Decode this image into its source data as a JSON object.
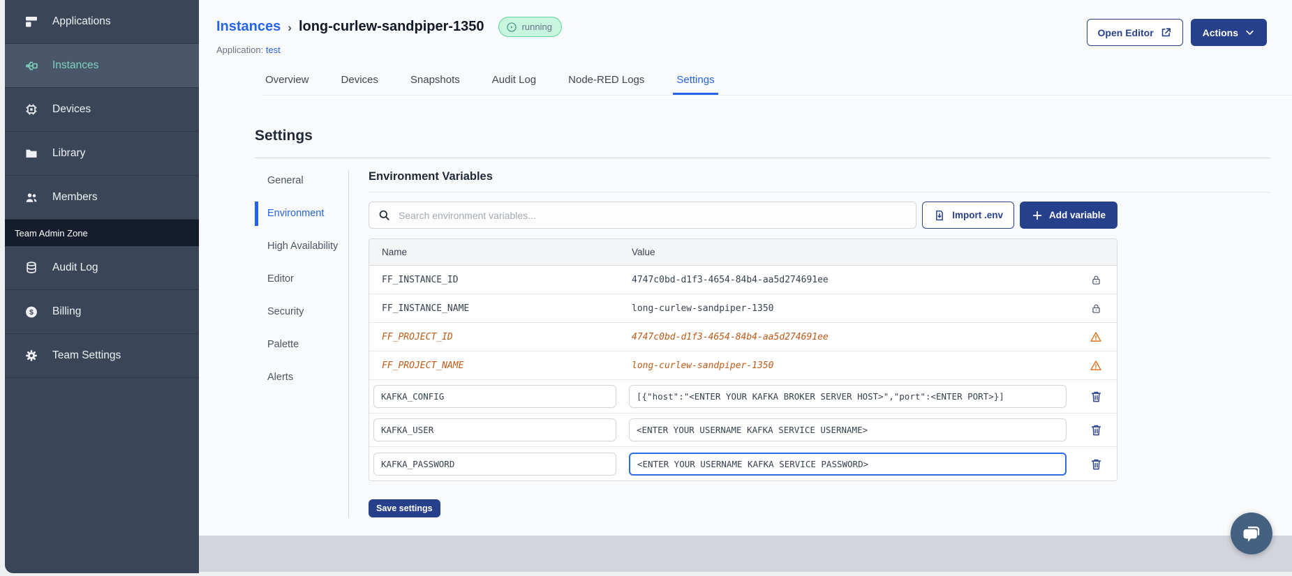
{
  "sidebar": {
    "items": [
      {
        "label": "Applications"
      },
      {
        "label": "Instances",
        "active": true
      },
      {
        "label": "Devices"
      },
      {
        "label": "Library"
      },
      {
        "label": "Members"
      }
    ],
    "section_label": "Team Admin Zone",
    "admin_items": [
      {
        "label": "Audit Log"
      },
      {
        "label": "Billing"
      },
      {
        "label": "Team Settings"
      }
    ]
  },
  "header": {
    "breadcrumb_parent": "Instances",
    "breadcrumb_separator": "›",
    "instance_name": "long-curlew-sandpiper-1350",
    "status_badge": "running",
    "application_label": "Application:",
    "application_name": "test",
    "open_editor_label": "Open Editor",
    "actions_label": "Actions"
  },
  "tabs": [
    {
      "label": "Overview"
    },
    {
      "label": "Devices"
    },
    {
      "label": "Snapshots"
    },
    {
      "label": "Audit Log"
    },
    {
      "label": "Node-RED Logs"
    },
    {
      "label": "Settings",
      "active": true
    }
  ],
  "settings": {
    "title": "Settings",
    "nav": [
      {
        "label": "General"
      },
      {
        "label": "Environment",
        "active": true
      },
      {
        "label": "High Availability"
      },
      {
        "label": "Editor"
      },
      {
        "label": "Security"
      },
      {
        "label": "Palette"
      },
      {
        "label": "Alerts"
      }
    ],
    "panel": {
      "title": "Environment Variables",
      "search_placeholder": "Search environment variables...",
      "import_label": "Import .env",
      "add_label": "Add variable",
      "columns": {
        "name": "Name",
        "value": "Value"
      },
      "rows": [
        {
          "name": "FF_INSTANCE_ID",
          "value": "4747c0bd-d1f3-4654-84b4-aa5d274691ee",
          "type": "locked"
        },
        {
          "name": "FF_INSTANCE_NAME",
          "value": "long-curlew-sandpiper-1350",
          "type": "locked"
        },
        {
          "name": "FF_PROJECT_ID",
          "value": "4747c0bd-d1f3-4654-84b4-aa5d274691ee",
          "type": "deprecated"
        },
        {
          "name": "FF_PROJECT_NAME",
          "value": "long-curlew-sandpiper-1350",
          "type": "deprecated"
        },
        {
          "name": "KAFKA_CONFIG",
          "value": "[{\"host\":\"<ENTER YOUR KAFKA BROKER SERVER HOST>\",\"port\":<ENTER PORT>}]",
          "type": "editable"
        },
        {
          "name": "KAFKA_USER",
          "value": "<ENTER YOUR USERNAME KAFKA SERVICE USERNAME>",
          "type": "editable"
        },
        {
          "name": "KAFKA_PASSWORD",
          "value": "<ENTER YOUR USERNAME KAFKA SERVICE PASSWORD>",
          "type": "editable",
          "focused": true
        }
      ],
      "save_label": "Save settings"
    }
  },
  "colors": {
    "navy_accent": "#27408c",
    "link_blue": "#2563eb",
    "sidebar_bg": "#3a4557",
    "sidebar_active_teal": "#7dd3c0",
    "deprecated_orange": "#be5a18",
    "running_badge_bg": "#c8f5dd",
    "running_badge_border": "#5fd49a",
    "footer_band": "#d2d5dc"
  }
}
